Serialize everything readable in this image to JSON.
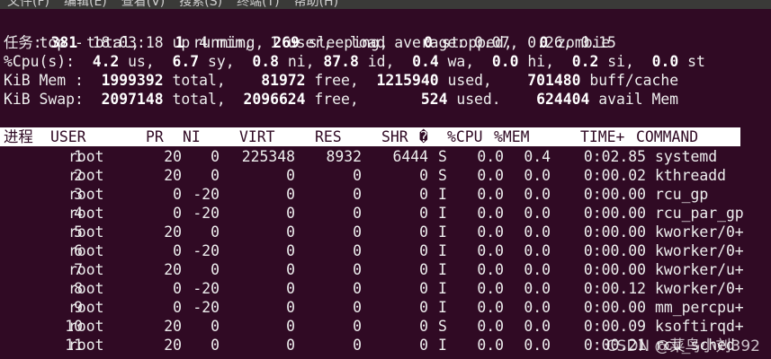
{
  "menu": [
    "文件(F)",
    "编辑(E)",
    "查看(V)",
    "搜索(S)",
    "终端(T)",
    "帮助(H)"
  ],
  "summary": {
    "top_line": "top - 18:03:18 up 4 min,  1 user,  load average: 0.07, 0.26, 0.15",
    "tasks": {
      "label": "任务:",
      "total": "381",
      "total_label": " total,",
      "running": "1",
      "running_label": " running,",
      "sleeping": "269",
      "sleeping_label": " sleeping,",
      "stopped": "0",
      "stopped_label": " stopped,",
      "zombie": "0",
      "zombie_label": " zombie"
    },
    "cpu": {
      "label": "%Cpu(s):",
      "us": "4.2",
      "us_label": " us,",
      "sy": "6.7",
      "sy_label": " sy,",
      "ni": "0.8",
      "ni_label": " ni,",
      "id": "87.8",
      "id_label": " id,",
      "wa": "0.4",
      "wa_label": " wa,",
      "hi": "0.0",
      "hi_label": " hi,",
      "si": "0.2",
      "si_label": " si,",
      "st": "0.0",
      "st_label": " st"
    },
    "mem": {
      "label": "KiB Mem :",
      "total": "1999392",
      "total_label": " total,",
      "free": "81972",
      "free_label": " free,",
      "used": "1215940",
      "used_label": " used,",
      "cache": "701480",
      "cache_label": " buff/cache"
    },
    "swap": {
      "label": "KiB Swap:",
      "total": "2097148",
      "total_label": " total,",
      "free": "2096624",
      "free_label": " free,",
      "used": "524",
      "used_label": " used.",
      "avail": "624404",
      "avail_label": " avail Mem"
    }
  },
  "table": {
    "headers": {
      "pid": "进程",
      "user": "USER",
      "pr": "PR",
      "ni": "NI",
      "virt": "VIRT",
      "res": "RES",
      "shr": "SHR",
      "sort_marker": "�",
      "s": "",
      "cpu": "%CPU",
      "mem": "%MEM",
      "time": "TIME+",
      "command": "COMMAND"
    },
    "rows": [
      {
        "pid": "1",
        "user": "root",
        "pr": "20",
        "ni": "0",
        "virt": "225348",
        "res": "8932",
        "shr": "6444",
        "s": "S",
        "cpu": "0.0",
        "mem": "0.4",
        "time": "0:02.85",
        "command": "systemd"
      },
      {
        "pid": "2",
        "user": "root",
        "pr": "20",
        "ni": "0",
        "virt": "0",
        "res": "0",
        "shr": "0",
        "s": "S",
        "cpu": "0.0",
        "mem": "0.0",
        "time": "0:00.02",
        "command": "kthreadd"
      },
      {
        "pid": "3",
        "user": "root",
        "pr": "0",
        "ni": "-20",
        "virt": "0",
        "res": "0",
        "shr": "0",
        "s": "I",
        "cpu": "0.0",
        "mem": "0.0",
        "time": "0:00.00",
        "command": "rcu_gp"
      },
      {
        "pid": "4",
        "user": "root",
        "pr": "0",
        "ni": "-20",
        "virt": "0",
        "res": "0",
        "shr": "0",
        "s": "I",
        "cpu": "0.0",
        "mem": "0.0",
        "time": "0:00.00",
        "command": "rcu_par_gp"
      },
      {
        "pid": "5",
        "user": "root",
        "pr": "20",
        "ni": "0",
        "virt": "0",
        "res": "0",
        "shr": "0",
        "s": "I",
        "cpu": "0.0",
        "mem": "0.0",
        "time": "0:00.00",
        "command": "kworker/0+"
      },
      {
        "pid": "6",
        "user": "root",
        "pr": "0",
        "ni": "-20",
        "virt": "0",
        "res": "0",
        "shr": "0",
        "s": "I",
        "cpu": "0.0",
        "mem": "0.0",
        "time": "0:00.00",
        "command": "kworker/0+"
      },
      {
        "pid": "7",
        "user": "root",
        "pr": "20",
        "ni": "0",
        "virt": "0",
        "res": "0",
        "shr": "0",
        "s": "I",
        "cpu": "0.0",
        "mem": "0.0",
        "time": "0:00.00",
        "command": "kworker/u+"
      },
      {
        "pid": "8",
        "user": "root",
        "pr": "0",
        "ni": "-20",
        "virt": "0",
        "res": "0",
        "shr": "0",
        "s": "I",
        "cpu": "0.0",
        "mem": "0.0",
        "time": "0:00.12",
        "command": "kworker/0+"
      },
      {
        "pid": "9",
        "user": "root",
        "pr": "0",
        "ni": "-20",
        "virt": "0",
        "res": "0",
        "shr": "0",
        "s": "I",
        "cpu": "0.0",
        "mem": "0.0",
        "time": "0:00.00",
        "command": "mm_percpu+"
      },
      {
        "pid": "10",
        "user": "root",
        "pr": "20",
        "ni": "0",
        "virt": "0",
        "res": "0",
        "shr": "0",
        "s": "S",
        "cpu": "0.0",
        "mem": "0.0",
        "time": "0:00.09",
        "command": "ksoftirqd+"
      },
      {
        "pid": "11",
        "user": "root",
        "pr": "20",
        "ni": "0",
        "virt": "0",
        "res": "0",
        "shr": "0",
        "s": "I",
        "cpu": "0.0",
        "mem": "0.0",
        "time": "0:00.21",
        "command": "rcu_sched"
      }
    ]
  },
  "watermark": "CSDN @菜鸟小刘392"
}
